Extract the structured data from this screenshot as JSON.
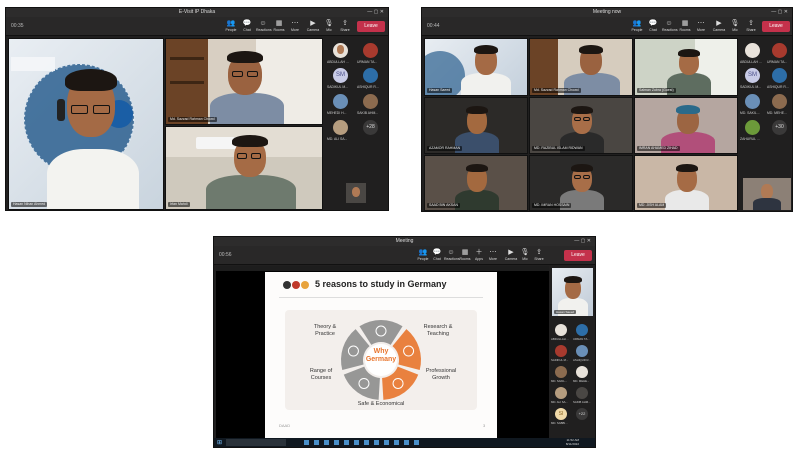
{
  "window1": {
    "title": "E-Visit IP Dhaka",
    "timer": "00:35",
    "toolbar": {
      "people": "People",
      "chat": "Chat",
      "reactions": "Reactions",
      "rooms": "Rooms",
      "more": "More",
      "camera": "Camera",
      "mic": "Mic",
      "share": "Share",
      "leave": "Leave"
    },
    "participants_main": [
      {
        "name": "Hasan Nihan Ahmed"
      },
      {
        "name": "Md. Sazzad Rahman Chowd"
      },
      {
        "name": "Irfan Mahdi"
      }
    ],
    "roster": [
      {
        "name": "ABDULLAH ...",
        "initials": ""
      },
      {
        "name": "URMAN TA...",
        "initials": ""
      },
      {
        "name": "SADIKUL M...",
        "initials": "SM"
      },
      {
        "name": "ASHIQUR R...",
        "initials": ""
      },
      {
        "name": "MEHEDI H...",
        "initials": ""
      },
      {
        "name": "SAKIB AHM...",
        "initials": ""
      },
      {
        "name": "MD. ALI SA...",
        "initials": ""
      },
      {
        "name": "+28",
        "initials": "+28"
      }
    ]
  },
  "window2": {
    "title": "Meeting now",
    "timer": "00:44",
    "toolbar": {
      "people": "People",
      "chat": "Chat",
      "reactions": "Reactions",
      "rooms": "Rooms",
      "more": "More",
      "camera": "Camera",
      "mic": "Mic",
      "share": "Share",
      "leave": "Leave"
    },
    "grid": [
      {
        "name": "Hasan Saeed"
      },
      {
        "name": "Md. Sazzad Rahman Chowd"
      },
      {
        "name": "Salman Zubra (Guest)"
      },
      {
        "name": "AZAMOR RAHMAN"
      },
      {
        "name": "MD. RAZIBUL ISLAM RIDWAN"
      },
      {
        "name": "IMRAN AHAMED ZIHAD"
      },
      {
        "name": "SAAD BIN AKSAN"
      },
      {
        "name": "MD. IMRAN HOSSAIN"
      },
      {
        "name": "MD. JISH ALAM"
      }
    ],
    "roster": [
      {
        "name": "ABDULLAH ...",
        "initials": ""
      },
      {
        "name": "URMAN TA...",
        "initials": ""
      },
      {
        "name": "SADIKUL M...",
        "initials": "SM"
      },
      {
        "name": "ASHIQUR R...",
        "initials": ""
      },
      {
        "name": "MD. SAKIL...",
        "initials": ""
      },
      {
        "name": "MD. MEHE...",
        "initials": ""
      },
      {
        "name": "ZAHURUL ...",
        "initials": ""
      },
      {
        "name": "+30",
        "initials": "+30"
      }
    ]
  },
  "window3": {
    "title": "Meeting",
    "timer": "00:56",
    "toolbar": {
      "people": "People",
      "chat": "Chat",
      "reactions": "Reactions",
      "rooms": "Rooms",
      "apps": "Apps",
      "more": "More",
      "camera": "Camera",
      "mic": "Mic",
      "share": "Share",
      "leave": "Leave"
    },
    "slide": {
      "title": "5 reasons to study in Germany",
      "center_line1": "Why",
      "center_line2": "Germany",
      "reasons": [
        "Theory &\nPractice",
        "Research &\nTeaching",
        "Professional\nGrowth",
        "Safe & Economical",
        "Range of\nCourses"
      ],
      "footer": "DAAD",
      "page": "3"
    },
    "presenter": "Hasan Saeed",
    "roster": [
      {
        "name": "ABDULLAH ...",
        "initials": ""
      },
      {
        "name": "URMAN TA...",
        "initials": ""
      },
      {
        "name": "SADIKUL M...",
        "initials": ""
      },
      {
        "name": "ASHIQUR R...",
        "initials": ""
      },
      {
        "name": "MD. SAKIL...",
        "initials": ""
      },
      {
        "name": "MD. MEHE...",
        "initials": ""
      },
      {
        "name": "MD. ALI SA...",
        "initials": ""
      },
      {
        "name": "SAKIB AHM...",
        "initials": ""
      },
      {
        "name": "MD. SABBI...",
        "initials": "SI"
      },
      {
        "name": "+22",
        "initials": "+22"
      }
    ],
    "taskbar": {
      "time": "11:52 AM",
      "date": "8/11/2022"
    }
  },
  "colors": {
    "leave": "#c4314b",
    "teams_dark": "#201f1f",
    "slide_orange": "#e8742c",
    "slide_grey": "#8d8d8d"
  }
}
